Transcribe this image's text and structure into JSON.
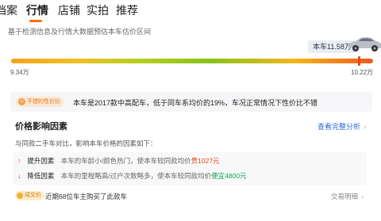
{
  "tabs": [
    {
      "label": "档案",
      "active": false
    },
    {
      "label": "行情",
      "active": true
    },
    {
      "label": "店铺",
      "active": false
    },
    {
      "label": "实拍",
      "active": false
    },
    {
      "label": "推荐",
      "active": false
    }
  ],
  "subtitle": "基于检测信息及行情大数据预估本车估价区间",
  "price": {
    "callout": "本车11.58万",
    "range_min": "9.34万",
    "range_max": "10.22万",
    "marker_fraction": 0.96,
    "car_icon": "car-thumbnail"
  },
  "verdict": {
    "tag": "不错的性价比",
    "tag_icon": "emoji-face-icon",
    "text": "本车是2017款中高配车，低于同车系均价的19%，车况正常情况下性价比不错"
  },
  "factors": {
    "title": "价格影响因素",
    "link": "查看完整分析",
    "link_chevron": "›",
    "desc": "与同款二手车对比，影响本车价格的因素如下：",
    "up": {
      "icon": "↑",
      "label": "提升因素",
      "text": "本车的车龄小/颜色热门，使本车较同款均价",
      "amount": "贵1027元"
    },
    "down": {
      "icon": "↓",
      "label": "降低因素",
      "text": "本车的里程略高/过户次数略多，使本车较同款均价",
      "amount": "便宜4800元"
    }
  },
  "deal": {
    "tag": "成交价",
    "text": "近期68位车主购买了此款车",
    "link": "交易明细",
    "link_chevron": "›"
  },
  "colors": {
    "accent": "#ff6a00",
    "link": "#2f6bd5",
    "up": "#e94b1b",
    "down": "#16a34a"
  }
}
